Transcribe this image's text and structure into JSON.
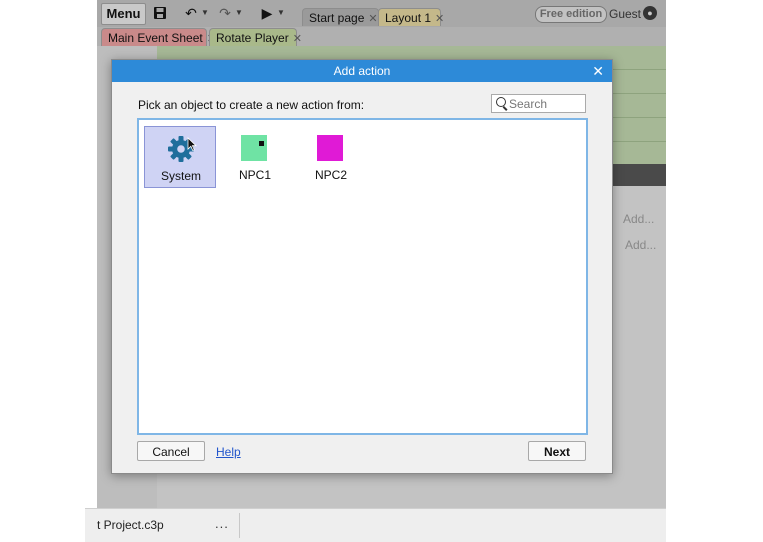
{
  "toolbar": {
    "menu_label": "Menu",
    "save_icon": "save-icon",
    "undo_icon": "undo-icon",
    "redo_icon": "redo-icon",
    "play_icon": "play-icon"
  },
  "top_tabs": [
    {
      "label": "Start page"
    },
    {
      "label": "Layout 1"
    }
  ],
  "edition_badge": "Free edition",
  "user_name": "Guest",
  "sheet_tabs": [
    {
      "label": "Main Event Sheet"
    },
    {
      "label": "Rotate Player"
    }
  ],
  "background": {
    "add_action_1": "Add...",
    "add_action_2": "Add..."
  },
  "dialog": {
    "title": "Add action",
    "prompt": "Pick an object to create a new action from:",
    "search_placeholder": "Search",
    "objects": [
      {
        "label": "System",
        "icon": "gear-icon",
        "selected": true
      },
      {
        "label": "NPC1",
        "color": "#6fe3a4",
        "selected": false
      },
      {
        "label": "NPC2",
        "color": "#e01ad6",
        "selected": false
      }
    ],
    "cancel_label": "Cancel",
    "help_label": "Help",
    "next_label": "Next"
  },
  "bottom_bar": {
    "project_name": "t Project.c3p",
    "more_label": "..."
  },
  "colors": {
    "title_bar": "#2d8ad8",
    "selection": "#cfd3f4",
    "gear": "#1f6e9c"
  }
}
